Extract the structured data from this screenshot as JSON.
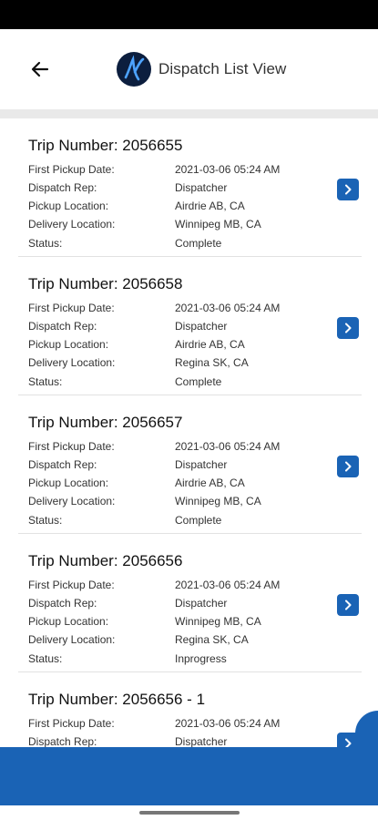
{
  "header": {
    "title": "Dispatch List View"
  },
  "field_labels": {
    "first_pickup": "First Pickup Date:",
    "dispatch_rep": "Dispatch Rep:",
    "pickup_location": "Pickup Location:",
    "delivery_location": "Delivery Location:",
    "status": "Status:"
  },
  "trips": [
    {
      "title": "Trip Number: 2056655",
      "first_pickup": "2021-03-06 05:24 AM",
      "dispatch_rep": "Dispatcher",
      "pickup_location": "Airdrie AB, CA",
      "delivery_location": "Winnipeg MB, CA",
      "status": "Complete"
    },
    {
      "title": "Trip Number: 2056658",
      "first_pickup": "2021-03-06 05:24 AM",
      "dispatch_rep": "Dispatcher",
      "pickup_location": "Airdrie AB, CA",
      "delivery_location": "Regina SK, CA",
      "status": "Complete"
    },
    {
      "title": "Trip Number: 2056657",
      "first_pickup": "2021-03-06 05:24 AM",
      "dispatch_rep": "Dispatcher",
      "pickup_location": "Airdrie AB, CA",
      "delivery_location": "Winnipeg MB, CA",
      "status": "Complete"
    },
    {
      "title": "Trip Number: 2056656",
      "first_pickup": "2021-03-06 05:24 AM",
      "dispatch_rep": "Dispatcher",
      "pickup_location": "Winnipeg MB, CA",
      "delivery_location": "Regina SK, CA",
      "status": "Inprogress"
    },
    {
      "title": "Trip Number: 2056656 - 1",
      "first_pickup": "2021-03-06 05:24 AM",
      "dispatch_rep": "Dispatcher",
      "pickup_location": "",
      "delivery_location": "",
      "status": ""
    }
  ],
  "colors": {
    "accent": "#1a63b5",
    "logo_bg": "#0c1e3e"
  },
  "icons": {
    "back": "arrow-left-icon",
    "open": "chevron-right-icon",
    "logo": "brand-logo"
  }
}
